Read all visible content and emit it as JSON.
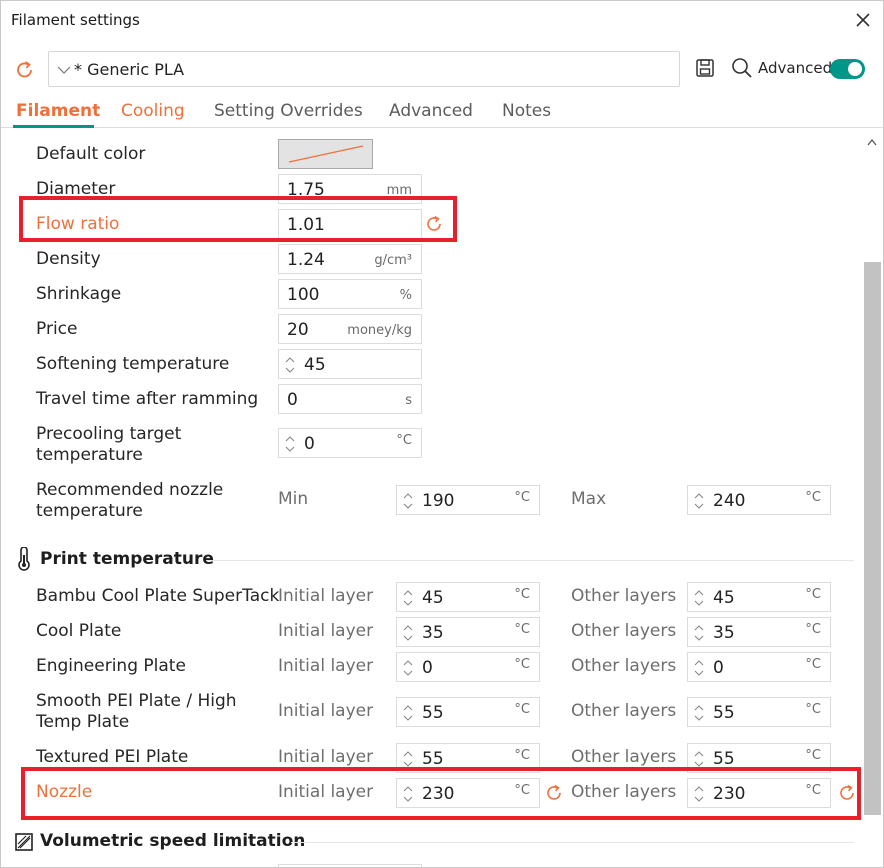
{
  "window": {
    "title": "Filament settings"
  },
  "preset": {
    "name": "* Generic PLA",
    "advanced_label": "Advanced",
    "advanced_on": true
  },
  "tabs": [
    "Filament",
    "Cooling",
    "Setting Overrides",
    "Advanced",
    "Notes"
  ],
  "filament": {
    "default_color": {
      "label": "Default color"
    },
    "diameter": {
      "label": "Diameter",
      "value": "1.75",
      "unit": "mm"
    },
    "flow_ratio": {
      "label": "Flow ratio",
      "value": "1.01"
    },
    "density": {
      "label": "Density",
      "value": "1.24",
      "unit": "g/cm³"
    },
    "shrinkage": {
      "label": "Shrinkage",
      "value": "100",
      "unit": "%"
    },
    "price": {
      "label": "Price",
      "value": "20",
      "unit": "money/kg"
    },
    "softening": {
      "label": "Softening temperature",
      "value": "45"
    },
    "travel_time": {
      "label": "Travel time after ramming",
      "value": "0",
      "unit": "s"
    },
    "precooling": {
      "label_line1": "Precooling target",
      "label_line2": "temperature",
      "value": "0",
      "unit": "°C"
    },
    "rec_nozzle": {
      "label_line1": "Recommended nozzle",
      "label_line2": "temperature",
      "min_label": "Min",
      "min_value": "190",
      "max_label": "Max",
      "max_value": "240",
      "unit": "°C"
    }
  },
  "print_temperature": {
    "title": "Print temperature",
    "initial_label": "Initial layer",
    "other_label": "Other layers",
    "unit": "°C",
    "rows": [
      {
        "label": "Bambu Cool Plate SuperTack",
        "initial": "45",
        "other": "45"
      },
      {
        "label": "Cool Plate",
        "initial": "35",
        "other": "35"
      },
      {
        "label": "Engineering Plate",
        "initial": "0",
        "other": "0"
      },
      {
        "label_line1": "Smooth PEI Plate / High",
        "label_line2": "Temp Plate",
        "initial": "55",
        "other": "55"
      },
      {
        "label": "Textured PEI Plate",
        "initial": "55",
        "other": "55"
      },
      {
        "label": "Nozzle",
        "initial": "230",
        "other": "230"
      }
    ]
  },
  "volumetric": {
    "title": "Volumetric speed limitation"
  },
  "colors": {
    "accent": "#f0703c",
    "toggle": "#009688",
    "highlight": "#e8202a"
  }
}
